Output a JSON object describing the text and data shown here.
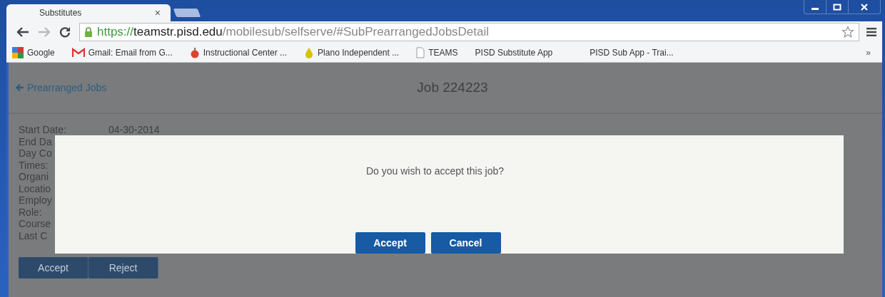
{
  "browser": {
    "tab": {
      "title": "Substitutes",
      "close": "×"
    },
    "url": {
      "scheme": "https://",
      "host": "teamstr.pisd.edu",
      "path": "/mobilesub/selfserve/#SubPrearrangedJobsDetail"
    },
    "bookmarks": [
      {
        "label": "Google",
        "kind": "google"
      },
      {
        "label": "Gmail: Email from G...",
        "kind": "gmail"
      },
      {
        "label": "Instructional Center ...",
        "kind": "apple"
      },
      {
        "label": "Plano Independent ...",
        "kind": "drop"
      },
      {
        "label": "TEAMS",
        "kind": "page"
      },
      {
        "label": "PISD Substitute App",
        "kind": "none"
      },
      {
        "label": "PISD Sub App - Trai...",
        "kind": "none"
      }
    ],
    "more": "»"
  },
  "page": {
    "back": "Prearranged Jobs",
    "title": "Job 224223",
    "details": [
      {
        "label": "Start Date:",
        "value": "04-30-2014"
      },
      {
        "label": "End Da"
      },
      {
        "label": "Day Co"
      },
      {
        "label": "Times:"
      },
      {
        "label": "Organi"
      },
      {
        "label": "Locatio"
      },
      {
        "label": "Employ"
      },
      {
        "label": "Role:"
      },
      {
        "label": "Course"
      },
      {
        "label": "Last C"
      }
    ],
    "actions": [
      "Accept",
      "Reject"
    ]
  },
  "dialog": {
    "message": "Do you wish to accept this job?",
    "buttons": [
      "Accept",
      "Cancel"
    ]
  }
}
